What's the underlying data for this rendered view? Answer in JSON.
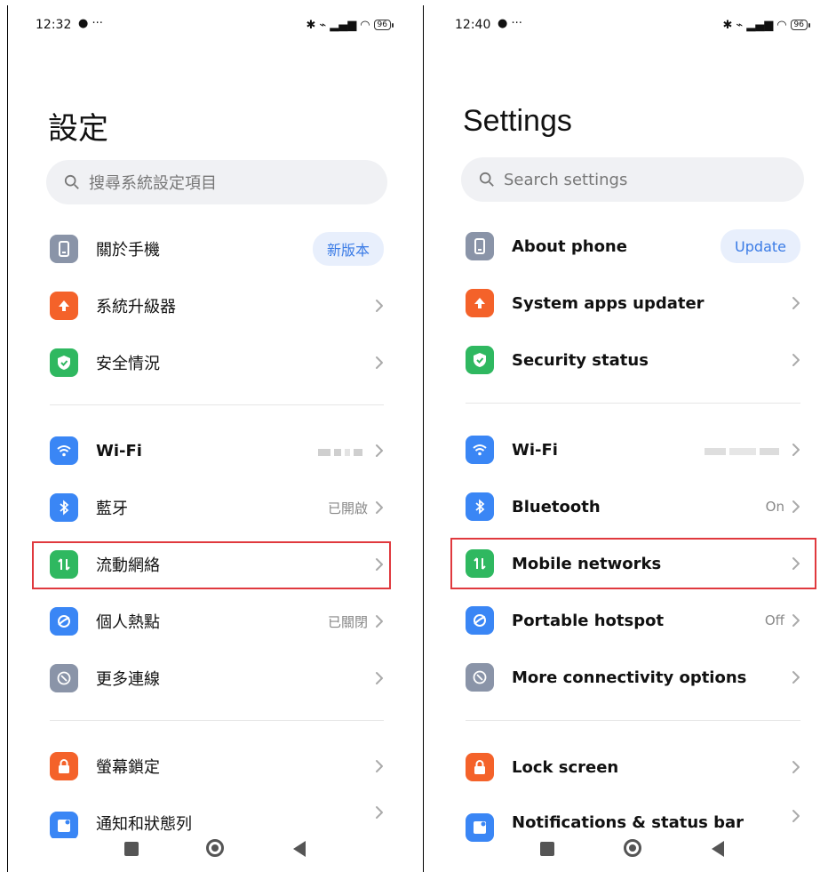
{
  "left": {
    "status": {
      "time": "12:32",
      "battery": "96"
    },
    "title": "設定",
    "search_placeholder": "搜尋系統設定項目",
    "about": {
      "label": "關於手機",
      "badge": "新版本"
    },
    "updater": {
      "label": "系統升級器"
    },
    "security": {
      "label": "安全情況"
    },
    "wifi": {
      "label": "Wi-Fi"
    },
    "bluetooth": {
      "label": "藍牙",
      "value": "已開啟"
    },
    "mobile": {
      "label": "流動網絡"
    },
    "hotspot": {
      "label": "個人熱點",
      "value": "已關閉"
    },
    "more": {
      "label": "更多連線"
    },
    "lock": {
      "label": "螢幕鎖定"
    },
    "notif": {
      "label": "通知和狀態列"
    }
  },
  "right": {
    "status": {
      "time": "12:40",
      "battery": "96"
    },
    "title": "Settings",
    "search_placeholder": "Search settings",
    "about": {
      "label": "About phone",
      "badge": "Update"
    },
    "updater": {
      "label": "System apps updater"
    },
    "security": {
      "label": "Security status"
    },
    "wifi": {
      "label": "Wi-Fi"
    },
    "bluetooth": {
      "label": "Bluetooth",
      "value": "On"
    },
    "mobile": {
      "label": "Mobile networks"
    },
    "hotspot": {
      "label": "Portable hotspot",
      "value": "Off"
    },
    "more": {
      "label": "More connectivity options"
    },
    "lock": {
      "label": "Lock screen"
    },
    "notif": {
      "label": "Notifications & status bar"
    }
  },
  "colors": {
    "about": "#8a94a8",
    "updater": "#f4622a",
    "security": "#2fb860",
    "wifi": "#3a86f5",
    "bluetooth": "#3a86f5",
    "mobile": "#2fb860",
    "hotspot": "#3a86f5",
    "more": "#8a94a8",
    "lock": "#f4622a",
    "notif": "#3a86f5",
    "highlight": "#e0393e",
    "badge_text": "#3a7be6"
  }
}
